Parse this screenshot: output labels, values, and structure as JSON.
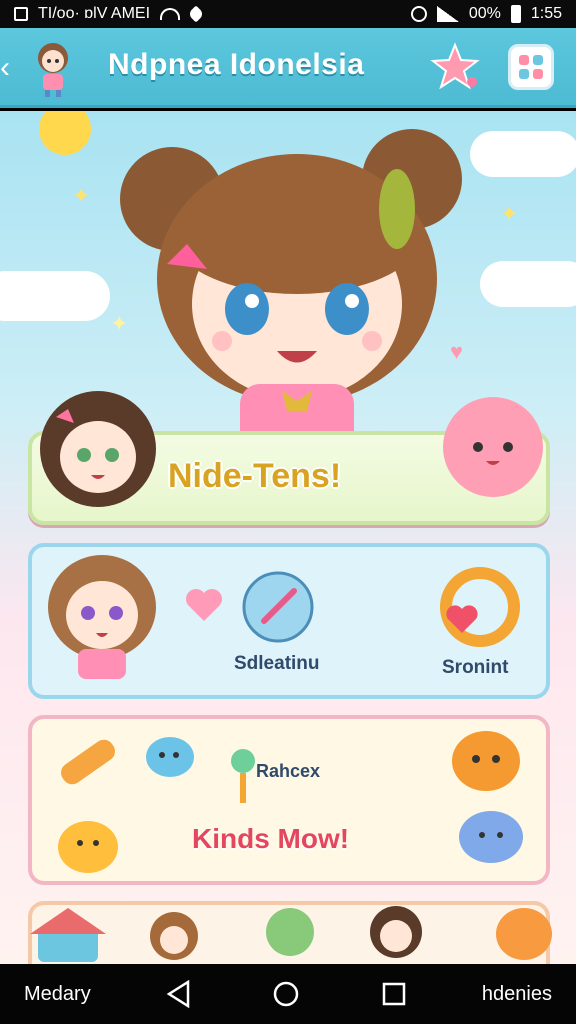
{
  "status_bar": {
    "left_text": "TI/oo· ɒlV AMEI",
    "battery": "00%",
    "time": "1:55"
  },
  "header": {
    "title": "Ndpnea Idonelsia"
  },
  "hero": {
    "title": "Nide-Tens!"
  },
  "card1": {
    "label_left": "Sdleatinu",
    "label_right": "Sronint"
  },
  "card2": {
    "label_top": "Rahcex",
    "label_main": "Kinds Mow!"
  },
  "nav": {
    "left_label": "Medary",
    "right_label": "hdenies"
  },
  "colors": {
    "header": "#4dbbd3",
    "accent_pink": "#e3465e",
    "hero_gold": "#d9a322"
  },
  "icons": [
    "back-arrow-icon",
    "star-icon",
    "grid-icon",
    "wifi-icon",
    "heart-icon",
    "alarm-icon",
    "signal-icon",
    "battery-icon",
    "home-icon",
    "back-icon",
    "circle-home-icon",
    "recents-icon"
  ]
}
